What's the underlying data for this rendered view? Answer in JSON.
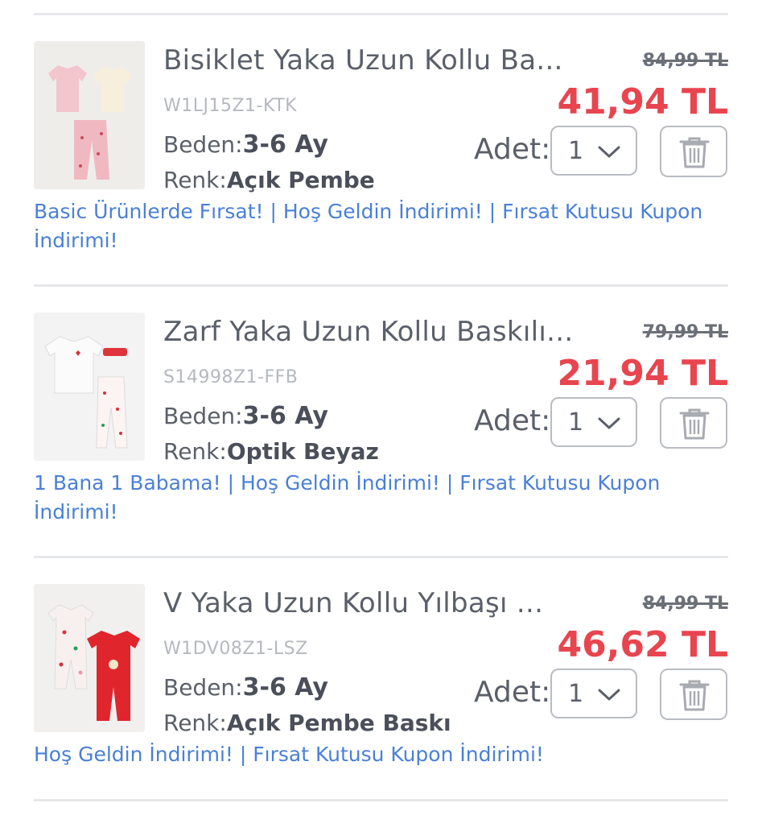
{
  "qty_label": "Adet:",
  "colors": {
    "accent_price": "#e8454f",
    "promo_link": "#4a80d6"
  },
  "items": [
    {
      "title": "Bisiklet Yaka Uzun Kollu Ba...",
      "sku": "W1LJ15Z1-KTK",
      "size_label": "Beden:",
      "size": "3-6 Ay",
      "color_label": "Renk:",
      "color": "Açık Pembe",
      "old_price": "84,99 TL",
      "new_price": "41,94 TL",
      "qty": "1",
      "promo": "Basic Ürünlerde Fırsat! | Hoş Geldin İndirimi! | Fırsat Kutusu Kupon İndirimi!",
      "icon": "trash-icon"
    },
    {
      "title": "Zarf Yaka Uzun Kollu Baskılı...",
      "sku": "S14998Z1-FFB",
      "size_label": "Beden:",
      "size": "3-6 Ay",
      "color_label": "Renk:",
      "color": "Optik Beyaz",
      "old_price": "79,99 TL",
      "new_price": "21,94 TL",
      "qty": "1",
      "promo": "1 Bana 1 Babama! | Hoş Geldin İndirimi! | Fırsat Kutusu Kupon İndirimi!",
      "icon": "trash-icon"
    },
    {
      "title": "V Yaka Uzun Kollu Yılbaşı ...",
      "sku": "W1DV08Z1-LSZ",
      "size_label": "Beden:",
      "size": "3-6 Ay",
      "color_label": "Renk:",
      "color": "Açık Pembe Baskı",
      "old_price": "84,99 TL",
      "new_price": "46,62 TL",
      "qty": "1",
      "promo": "Hoş Geldin İndirimi! | Fırsat Kutusu Kupon İndirimi!",
      "icon": "trash-icon"
    }
  ]
}
